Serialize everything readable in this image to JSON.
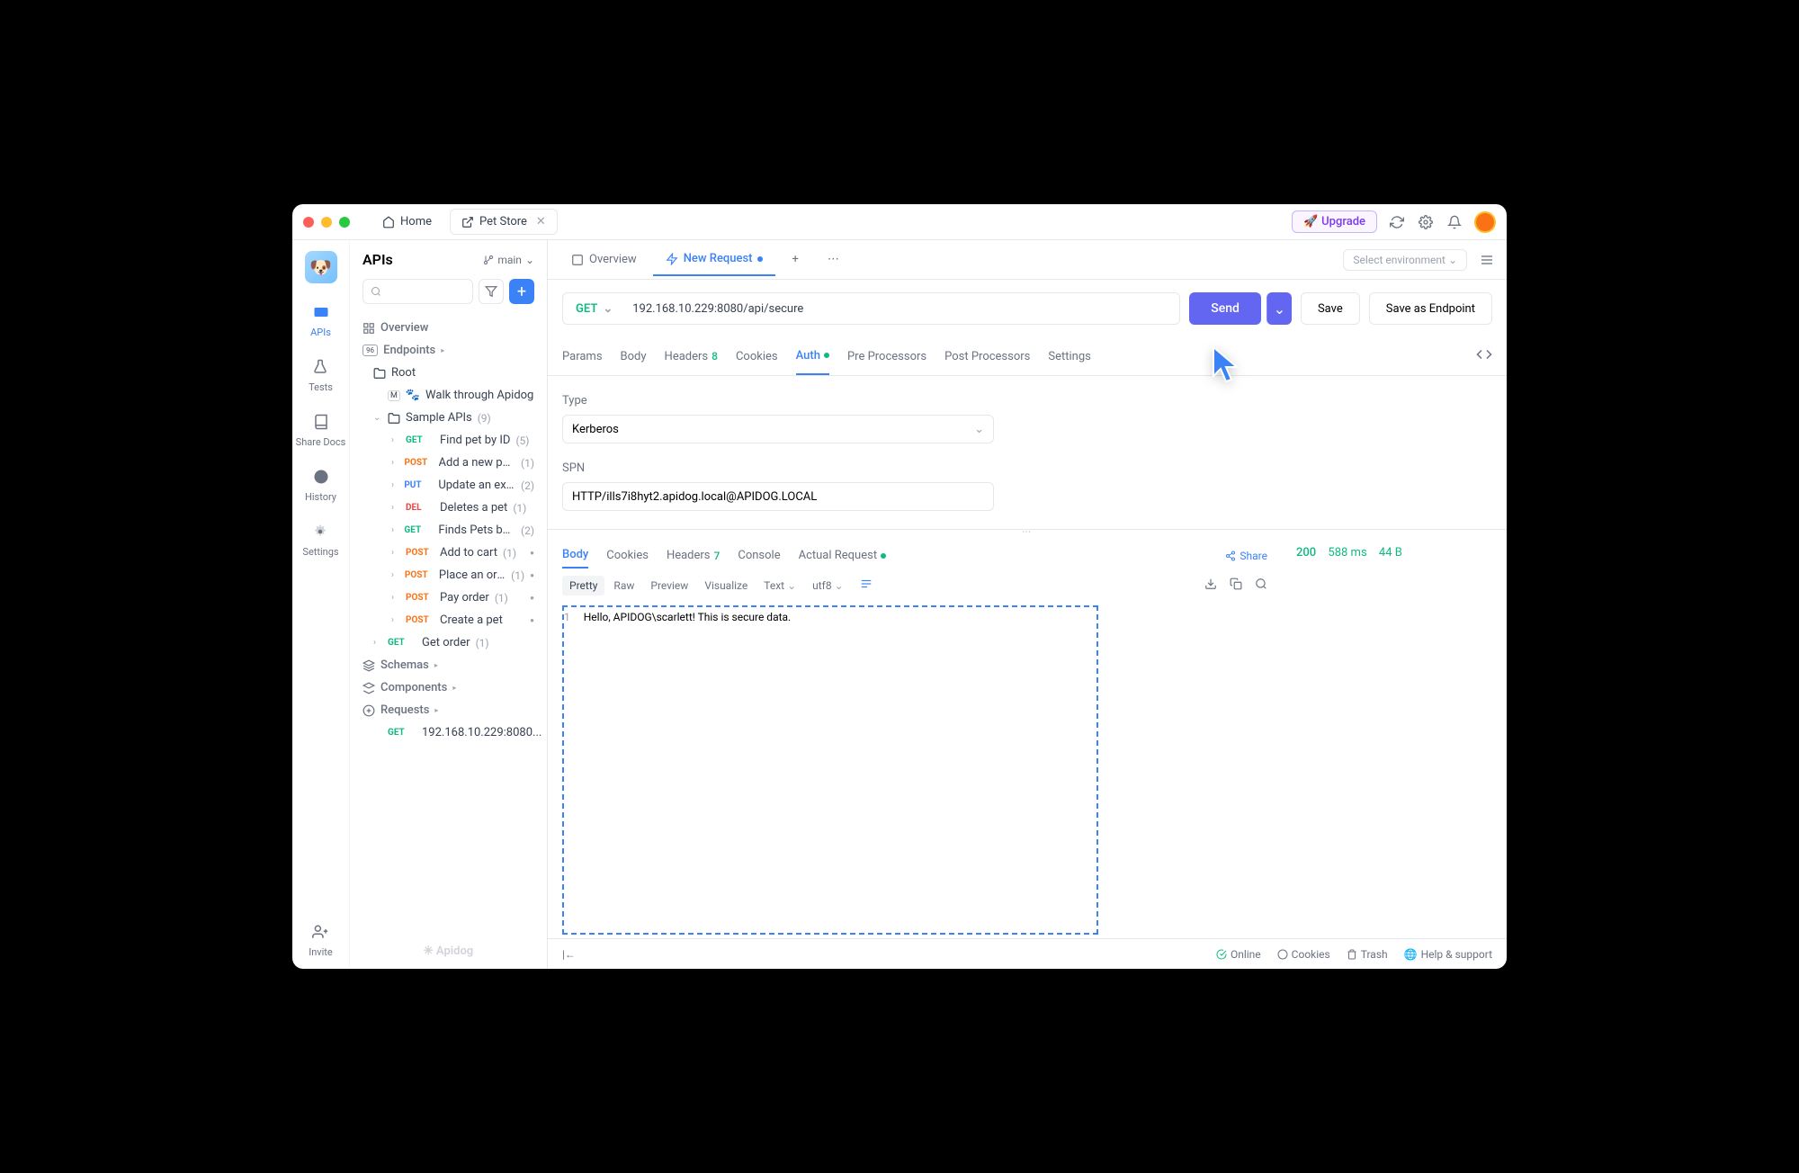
{
  "titlebar": {
    "home": "Home",
    "tab": "Pet Store",
    "upgrade": "Upgrade"
  },
  "rail": {
    "apis": "APIs",
    "tests": "Tests",
    "shareDocs": "Share Docs",
    "history": "History",
    "settings": "Settings",
    "invite": "Invite"
  },
  "sidebar": {
    "title": "APIs",
    "branch": "main",
    "overview": "Overview",
    "endpoints": "Endpoints",
    "root": "Root",
    "walkthrough": "Walk through Apidog",
    "sampleApis": "Sample APIs",
    "sampleCount": "(9)",
    "items": [
      {
        "method": "GET",
        "name": "Find pet by ID",
        "count": "(5)"
      },
      {
        "method": "POST",
        "name": "Add a new pet t...",
        "count": "(1)"
      },
      {
        "method": "PUT",
        "name": "Update an existi...",
        "count": "(2)"
      },
      {
        "method": "DEL",
        "name": "Deletes a pet",
        "count": "(1)"
      },
      {
        "method": "GET",
        "name": "Finds Pets by st...",
        "count": "(2)"
      },
      {
        "method": "POST",
        "name": "Add to cart",
        "count": "(1)"
      },
      {
        "method": "POST",
        "name": "Place an order",
        "count": "(1)"
      },
      {
        "method": "POST",
        "name": "Pay order",
        "count": "(1)"
      },
      {
        "method": "POST",
        "name": "Create a pet",
        "count": ""
      }
    ],
    "getOrder": {
      "method": "GET",
      "name": "Get order",
      "count": "(1)"
    },
    "schemas": "Schemas",
    "components": "Components",
    "requests": "Requests",
    "reqItem": {
      "method": "GET",
      "name": "192.168.10.229:8080..."
    },
    "brand": "Apidog"
  },
  "content": {
    "tabOverview": "Overview",
    "tabNewRequest": "New Request",
    "envPlaceholder": "Select environment",
    "method": "GET",
    "url": "192.168.10.229:8080/api/secure",
    "send": "Send",
    "save": "Save",
    "saveAs": "Save as Endpoint",
    "reqTabs": {
      "params": "Params",
      "body": "Body",
      "headers": "Headers",
      "headersBadge": "8",
      "cookies": "Cookies",
      "auth": "Auth",
      "pre": "Pre Processors",
      "post": "Post Processors",
      "settings": "Settings"
    },
    "auth": {
      "typeLabel": "Type",
      "typeValue": "Kerberos",
      "spnLabel": "SPN",
      "spnValue": "HTTP/ills7i8hyt2.apidog.local@APIDOG.LOCAL"
    }
  },
  "response": {
    "tabs": {
      "body": "Body",
      "cookies": "Cookies",
      "headers": "Headers",
      "headersBadge": "7",
      "console": "Console",
      "actual": "Actual Request"
    },
    "share": "Share",
    "viewTabs": {
      "pretty": "Pretty",
      "raw": "Raw",
      "preview": "Preview",
      "visualize": "Visualize",
      "text": "Text",
      "utf8": "utf8"
    },
    "lineNo": "1",
    "bodyText": "Hello, APIDOG\\scarlett! This is secure data.",
    "status": "200",
    "time": "588 ms",
    "size": "44 B"
  },
  "statusbar": {
    "online": "Online",
    "cookies": "Cookies",
    "trash": "Trash",
    "help": "Help & support"
  }
}
